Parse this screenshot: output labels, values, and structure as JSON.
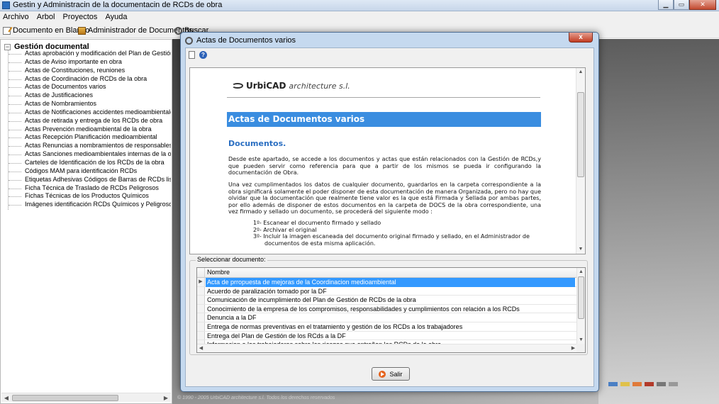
{
  "window": {
    "title": "Gestin y Administracin de la documentacin de RCDs de obra",
    "minimize": "▁",
    "maximize": "▭",
    "close": "✕"
  },
  "menu": [
    "Archivo",
    "Arbol",
    "Proyectos",
    "Ayuda"
  ],
  "toolbar": {
    "new_doc": "Documento en Blanco",
    "admin": "Administrador de Documentos",
    "search": "Buscar"
  },
  "tree": {
    "expander": "−",
    "root": "Gestión documental",
    "items": [
      "Actas aprobación y modificación del Plan de Gestión RCDs",
      "Actas de Aviso importante en obra",
      "Actas de Constituciones, reuniones",
      "Actas de Coordinación de RCDs de la obra",
      "Actas de Documentos varios",
      "Actas de Justificaciones",
      "Actas de Nombramientos",
      "Actas de Notificaciones accidentes medioambientales",
      "Actas de retirada y entrega de los RCDs de obra",
      "Actas Prevención medioambiental de la obra",
      "Actas Recepción Planificación medioambiental",
      "Actas Renuncias a nombramientos de responsables medioambientales",
      "Actas Sanciones medioambientales internas de la obra",
      "Carteles de Identificación de los RCDs de la obra",
      "Códigos MAM para identificación RCDs",
      "Etiquetas Adhesivas Códigos de Barras de RCDs lista MAM",
      "Ficha Técnica de Traslado de RCDs Peligrosos",
      "Fichas Técnicas de los Productos Químicos",
      "Imágenes identificación RCDs Químicos y Peligrosos"
    ]
  },
  "background": {
    "footer": "© 1990 - 2005 UrbiCAD architecture s.l. Todos los derechos reservados"
  },
  "dialog": {
    "title": "Actas de Documentos varios",
    "close": "x",
    "help": "?",
    "document": {
      "brand": "UrbiCAD",
      "brand_sub": "architecture s.l.",
      "banner": "Actas de Documentos varios",
      "heading": "Documentos.",
      "p1": "Desde este apartado, se accede a los documentos y actas que están relacionados con la Gestión de RCDs,y que pueden servir como referencia para que a partir de los mismos se pueda ir configurando la documentación de Obra.",
      "p2": "Una vez cumplimentados los datos de cualquier documento, guardarlos en la carpeta correspondiente a la obra significará solamente el poder disponer de esta documentación de manera Organizada, pero no hay que olvidar que la documentación que realmente tiene valor es la que está Firmada y Sellada por ambas partes, por ello además de disponer de estos documentos en la carpeta de DOCS de la obra correspondiente, una vez firmado y sellado un documento, se procederá del siguiente modo :",
      "steps": [
        "1º- Escanear el documento firmado y sellado",
        "2º- Archivar el original",
        "3º- Incluir la imagen escaneada del documento original firmado y sellado, en el Administrador de documentos de esta misma aplicación."
      ]
    },
    "select_label": "Seleccionar documento:",
    "grid": {
      "column": "Nombre",
      "rows": [
        "Acta de prropuesta de mejoras de la Coordinacion medioambiental",
        "Acuerdo de paralización tomado por la DF",
        "Comunicación de incumplimiento del Plan de Gestión de RCDs de la obra",
        "Conocimiento de la empresa de los compromisos, responsabilidades y cumplimientos con relación a los RCDs",
        "Denuncia a la DF",
        "Entrega de normas preventivas en el tratamiento y gestión de los RCDs a los trabajadores",
        "Entrega del Plan de Gestión de los RCds a la DF",
        "Informacion a los trabajadores sobre los riesgos que entrañan los RCDs de la obra"
      ],
      "selected_index": 0
    },
    "exit_label": "Salir"
  }
}
